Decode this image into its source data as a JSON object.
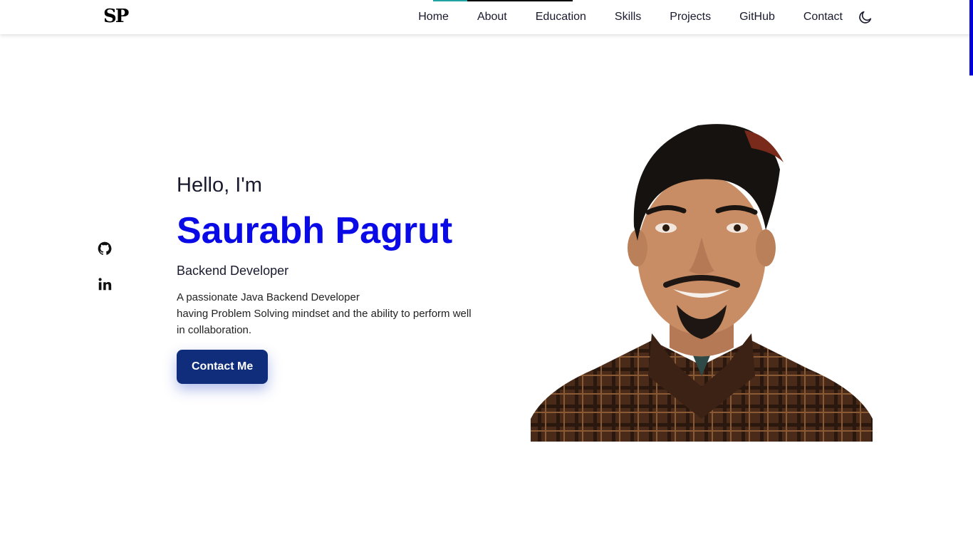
{
  "header": {
    "logo": "SP",
    "nav": [
      "Home",
      "About",
      "Education",
      "Skills",
      "Projects",
      "GitHub",
      "Contact"
    ],
    "active_nav": "Home",
    "theme_toggle_icon": "moon-icon"
  },
  "social": {
    "items": [
      {
        "icon": "github-icon"
      },
      {
        "icon": "linkedin-icon"
      }
    ]
  },
  "hero": {
    "greeting": "Hello, I'm",
    "name": "Saurabh Pagrut",
    "role": "Backend Developer",
    "description_lines": [
      "A passionate Java Backend Developer",
      "having Problem Solving mindset and the ability to perform well",
      "in collaboration."
    ],
    "cta_label": "Contact Me"
  },
  "colors": {
    "accent": "#0a0ae6",
    "button": "#0f2d7a",
    "active_indicator": "#1fa3a3",
    "scroll_indicator": "#0000d8"
  }
}
